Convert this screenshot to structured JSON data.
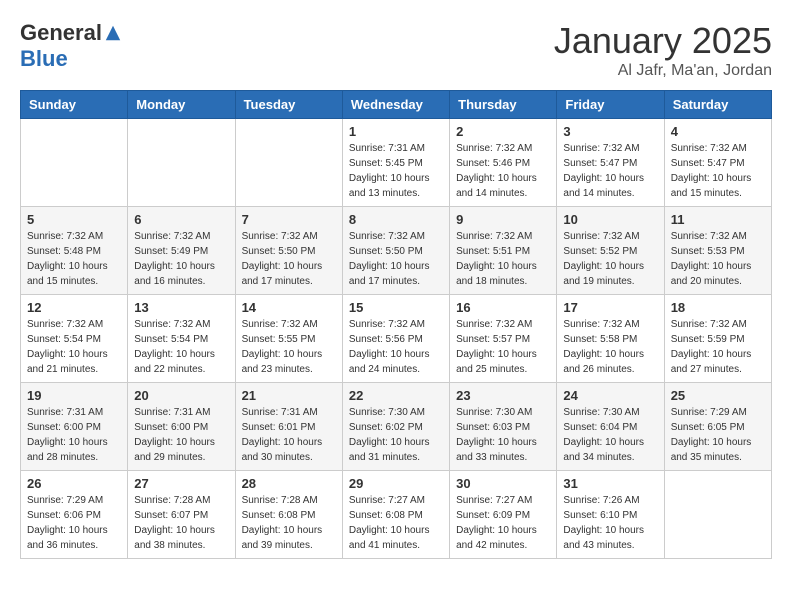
{
  "header": {
    "logo_general": "General",
    "logo_blue": "Blue",
    "month_title": "January 2025",
    "location": "Al Jafr, Ma'an, Jordan"
  },
  "weekdays": [
    "Sunday",
    "Monday",
    "Tuesday",
    "Wednesday",
    "Thursday",
    "Friday",
    "Saturday"
  ],
  "weeks": [
    [
      {
        "day": "",
        "detail": ""
      },
      {
        "day": "",
        "detail": ""
      },
      {
        "day": "",
        "detail": ""
      },
      {
        "day": "1",
        "detail": "Sunrise: 7:31 AM\nSunset: 5:45 PM\nDaylight: 10 hours\nand 13 minutes."
      },
      {
        "day": "2",
        "detail": "Sunrise: 7:32 AM\nSunset: 5:46 PM\nDaylight: 10 hours\nand 14 minutes."
      },
      {
        "day": "3",
        "detail": "Sunrise: 7:32 AM\nSunset: 5:47 PM\nDaylight: 10 hours\nand 14 minutes."
      },
      {
        "day": "4",
        "detail": "Sunrise: 7:32 AM\nSunset: 5:47 PM\nDaylight: 10 hours\nand 15 minutes."
      }
    ],
    [
      {
        "day": "5",
        "detail": "Sunrise: 7:32 AM\nSunset: 5:48 PM\nDaylight: 10 hours\nand 15 minutes."
      },
      {
        "day": "6",
        "detail": "Sunrise: 7:32 AM\nSunset: 5:49 PM\nDaylight: 10 hours\nand 16 minutes."
      },
      {
        "day": "7",
        "detail": "Sunrise: 7:32 AM\nSunset: 5:50 PM\nDaylight: 10 hours\nand 17 minutes."
      },
      {
        "day": "8",
        "detail": "Sunrise: 7:32 AM\nSunset: 5:50 PM\nDaylight: 10 hours\nand 17 minutes."
      },
      {
        "day": "9",
        "detail": "Sunrise: 7:32 AM\nSunset: 5:51 PM\nDaylight: 10 hours\nand 18 minutes."
      },
      {
        "day": "10",
        "detail": "Sunrise: 7:32 AM\nSunset: 5:52 PM\nDaylight: 10 hours\nand 19 minutes."
      },
      {
        "day": "11",
        "detail": "Sunrise: 7:32 AM\nSunset: 5:53 PM\nDaylight: 10 hours\nand 20 minutes."
      }
    ],
    [
      {
        "day": "12",
        "detail": "Sunrise: 7:32 AM\nSunset: 5:54 PM\nDaylight: 10 hours\nand 21 minutes."
      },
      {
        "day": "13",
        "detail": "Sunrise: 7:32 AM\nSunset: 5:54 PM\nDaylight: 10 hours\nand 22 minutes."
      },
      {
        "day": "14",
        "detail": "Sunrise: 7:32 AM\nSunset: 5:55 PM\nDaylight: 10 hours\nand 23 minutes."
      },
      {
        "day": "15",
        "detail": "Sunrise: 7:32 AM\nSunset: 5:56 PM\nDaylight: 10 hours\nand 24 minutes."
      },
      {
        "day": "16",
        "detail": "Sunrise: 7:32 AM\nSunset: 5:57 PM\nDaylight: 10 hours\nand 25 minutes."
      },
      {
        "day": "17",
        "detail": "Sunrise: 7:32 AM\nSunset: 5:58 PM\nDaylight: 10 hours\nand 26 minutes."
      },
      {
        "day": "18",
        "detail": "Sunrise: 7:32 AM\nSunset: 5:59 PM\nDaylight: 10 hours\nand 27 minutes."
      }
    ],
    [
      {
        "day": "19",
        "detail": "Sunrise: 7:31 AM\nSunset: 6:00 PM\nDaylight: 10 hours\nand 28 minutes."
      },
      {
        "day": "20",
        "detail": "Sunrise: 7:31 AM\nSunset: 6:00 PM\nDaylight: 10 hours\nand 29 minutes."
      },
      {
        "day": "21",
        "detail": "Sunrise: 7:31 AM\nSunset: 6:01 PM\nDaylight: 10 hours\nand 30 minutes."
      },
      {
        "day": "22",
        "detail": "Sunrise: 7:30 AM\nSunset: 6:02 PM\nDaylight: 10 hours\nand 31 minutes."
      },
      {
        "day": "23",
        "detail": "Sunrise: 7:30 AM\nSunset: 6:03 PM\nDaylight: 10 hours\nand 33 minutes."
      },
      {
        "day": "24",
        "detail": "Sunrise: 7:30 AM\nSunset: 6:04 PM\nDaylight: 10 hours\nand 34 minutes."
      },
      {
        "day": "25",
        "detail": "Sunrise: 7:29 AM\nSunset: 6:05 PM\nDaylight: 10 hours\nand 35 minutes."
      }
    ],
    [
      {
        "day": "26",
        "detail": "Sunrise: 7:29 AM\nSunset: 6:06 PM\nDaylight: 10 hours\nand 36 minutes."
      },
      {
        "day": "27",
        "detail": "Sunrise: 7:28 AM\nSunset: 6:07 PM\nDaylight: 10 hours\nand 38 minutes."
      },
      {
        "day": "28",
        "detail": "Sunrise: 7:28 AM\nSunset: 6:08 PM\nDaylight: 10 hours\nand 39 minutes."
      },
      {
        "day": "29",
        "detail": "Sunrise: 7:27 AM\nSunset: 6:08 PM\nDaylight: 10 hours\nand 41 minutes."
      },
      {
        "day": "30",
        "detail": "Sunrise: 7:27 AM\nSunset: 6:09 PM\nDaylight: 10 hours\nand 42 minutes."
      },
      {
        "day": "31",
        "detail": "Sunrise: 7:26 AM\nSunset: 6:10 PM\nDaylight: 10 hours\nand 43 minutes."
      },
      {
        "day": "",
        "detail": ""
      }
    ]
  ]
}
